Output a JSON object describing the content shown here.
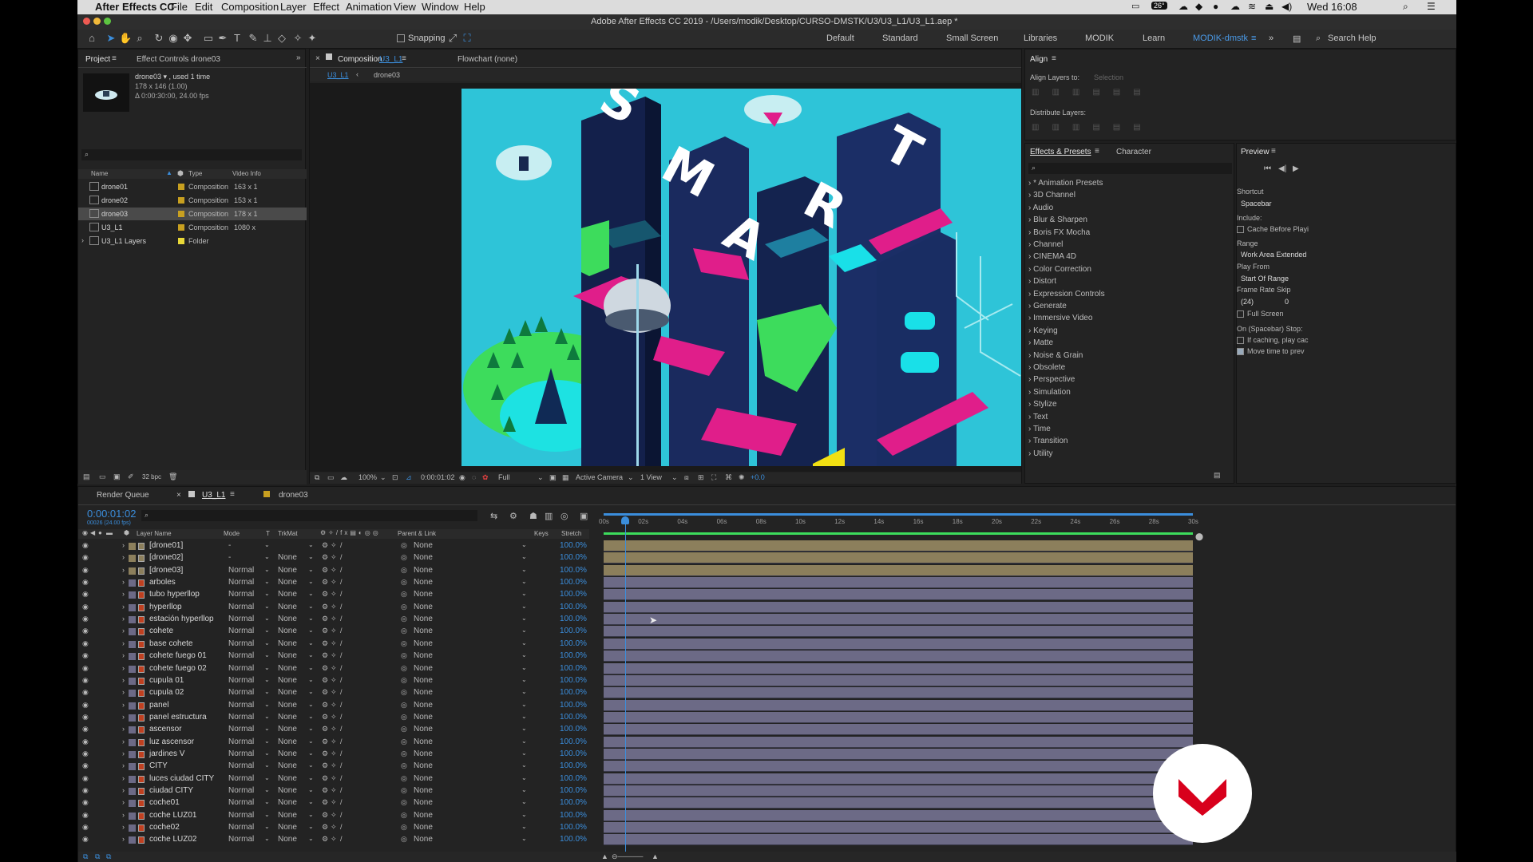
{
  "menubar": {
    "app": "After Effects CC",
    "items": [
      "File",
      "Edit",
      "Composition",
      "Layer",
      "Effect",
      "Animation",
      "View",
      "Window",
      "Help"
    ],
    "temp": "26°",
    "clock": "Wed 16:08"
  },
  "titlebar": {
    "title": "Adobe After Effects CC 2019 - /Users/modik/Desktop/CURSO-DMSTK/U3/U3_L1/U3_L1.aep *"
  },
  "toolbar": {
    "snapping": "Snapping",
    "workspaces": [
      "Default",
      "Standard",
      "Small Screen",
      "Libraries",
      "MODIK",
      "Learn"
    ],
    "active_workspace": "MODIK-dmstk",
    "search_placeholder": "Search Help"
  },
  "project": {
    "tab_project": "Project",
    "tab_effect_controls": "Effect Controls drone03",
    "selected_name": "drone03 ▾ , used 1 time",
    "selected_dims": "178 x 146 (1.00)",
    "selected_dur": "Δ 0:00:30:00, 24.00 fps",
    "columns": {
      "name": "Name",
      "type": "Type",
      "video": "Video Info"
    },
    "items": [
      {
        "name": "drone01",
        "type": "Composition",
        "info": "163 x 1"
      },
      {
        "name": "drone02",
        "type": "Composition",
        "info": "153 x 1"
      },
      {
        "name": "drone03",
        "type": "Composition",
        "info": "178 x 1"
      },
      {
        "name": "U3_L1",
        "type": "Composition",
        "info": "1080 x"
      },
      {
        "name": "U3_L1 Layers",
        "type": "Folder",
        "info": ""
      }
    ],
    "bpc": "32 bpc"
  },
  "composition": {
    "tab_label": "Composition",
    "tab_comp": "U3_L1",
    "flowchart": "Flowchart (none)",
    "crumb1": "U3_L1",
    "crumb2": "drone03",
    "zoom": "100%",
    "timecode": "0:00:01:02",
    "resolution": "Full",
    "camera": "Active Camera",
    "views": "1 View",
    "exposure": "+0.0",
    "art_text": "SMART"
  },
  "align": {
    "title": "Align",
    "align_to": "Align Layers to:",
    "selection": "Selection",
    "distribute": "Distribute Layers:"
  },
  "effects": {
    "tab": "Effects & Presets",
    "tab2": "Character",
    "categories": [
      "* Animation Presets",
      "3D Channel",
      "Audio",
      "Blur & Sharpen",
      "Boris FX Mocha",
      "Channel",
      "CINEMA 4D",
      "Color Correction",
      "Distort",
      "Expression Controls",
      "Generate",
      "Immersive Video",
      "Keying",
      "Matte",
      "Noise & Grain",
      "Obsolete",
      "Perspective",
      "Simulation",
      "Stylize",
      "Text",
      "Time",
      "Transition",
      "Utility"
    ]
  },
  "preview": {
    "title": "Preview",
    "shortcut_label": "Shortcut",
    "shortcut_value": "Spacebar",
    "include": "Include:",
    "cache": "Cache Before Playi",
    "range_label": "Range",
    "range_value": "Work Area Extended",
    "playfrom_label": "Play From",
    "playfrom_value": "Start Of Range",
    "framerate_label": "Frame Rate",
    "skip_label": "Skip",
    "framerate_value": "(24)",
    "skip_value": "0",
    "fullscreen": "Full Screen",
    "stop_label": "On (Spacebar) Stop:",
    "ifcaching": "If caching, play cac",
    "movetime": "Move time to prev"
  },
  "timeline": {
    "tab_render": "Render Queue",
    "tab_comp": "U3_L1",
    "tab_drone": "drone03",
    "timecode": "0:00:01:02",
    "fps_line": "00026 (24.00 fps)",
    "col_layer": "Layer Name",
    "col_mode": "Mode",
    "col_t": "T",
    "col_trk": "TrkMat",
    "col_parent": "Parent & Link",
    "col_keys": "Keys",
    "col_stretch": "Stretch",
    "ruler": [
      "00s",
      "02s",
      "04s",
      "06s",
      "08s",
      "10s",
      "12s",
      "14s",
      "16s",
      "18s",
      "20s",
      "22s",
      "24s",
      "26s",
      "28s",
      "30s"
    ],
    "playhead_seconds": 1.08,
    "layers": [
      {
        "name": "[drone01]",
        "mode": "-",
        "trk": "",
        "parent": "None",
        "stretch": "100.0%",
        "comp": true
      },
      {
        "name": "[drone02]",
        "mode": "-",
        "trk": "None",
        "parent": "None",
        "stretch": "100.0%",
        "comp": true
      },
      {
        "name": "[drone03]",
        "mode": "Normal",
        "trk": "None",
        "parent": "None",
        "stretch": "100.0%",
        "comp": true
      },
      {
        "name": "arboles",
        "mode": "Normal",
        "trk": "None",
        "parent": "None",
        "stretch": "100.0%"
      },
      {
        "name": "tubo hyperllop",
        "mode": "Normal",
        "trk": "None",
        "parent": "None",
        "stretch": "100.0%"
      },
      {
        "name": "hyperllop",
        "mode": "Normal",
        "trk": "None",
        "parent": "None",
        "stretch": "100.0%"
      },
      {
        "name": "estación hyperllop",
        "mode": "Normal",
        "trk": "None",
        "parent": "None",
        "stretch": "100.0%"
      },
      {
        "name": "cohete",
        "mode": "Normal",
        "trk": "None",
        "parent": "None",
        "stretch": "100.0%"
      },
      {
        "name": "base cohete",
        "mode": "Normal",
        "trk": "None",
        "parent": "None",
        "stretch": "100.0%"
      },
      {
        "name": "cohete fuego 01",
        "mode": "Normal",
        "trk": "None",
        "parent": "None",
        "stretch": "100.0%"
      },
      {
        "name": "cohete fuego 02",
        "mode": "Normal",
        "trk": "None",
        "parent": "None",
        "stretch": "100.0%"
      },
      {
        "name": "cupula 01",
        "mode": "Normal",
        "trk": "None",
        "parent": "None",
        "stretch": "100.0%"
      },
      {
        "name": "cupula 02",
        "mode": "Normal",
        "trk": "None",
        "parent": "None",
        "stretch": "100.0%"
      },
      {
        "name": "panel",
        "mode": "Normal",
        "trk": "None",
        "parent": "None",
        "stretch": "100.0%"
      },
      {
        "name": "panel estructura",
        "mode": "Normal",
        "trk": "None",
        "parent": "None",
        "stretch": "100.0%"
      },
      {
        "name": "ascensor",
        "mode": "Normal",
        "trk": "None",
        "parent": "None",
        "stretch": "100.0%"
      },
      {
        "name": "luz ascensor",
        "mode": "Normal",
        "trk": "None",
        "parent": "None",
        "stretch": "100.0%"
      },
      {
        "name": "jardines V",
        "mode": "Normal",
        "trk": "None",
        "parent": "None",
        "stretch": "100.0%"
      },
      {
        "name": "CITY",
        "mode": "Normal",
        "trk": "None",
        "parent": "None",
        "stretch": "100.0%"
      },
      {
        "name": "luces ciudad CITY",
        "mode": "Normal",
        "trk": "None",
        "parent": "None",
        "stretch": "100.0%"
      },
      {
        "name": "ciudad CITY",
        "mode": "Normal",
        "trk": "None",
        "parent": "None",
        "stretch": "100.0%"
      },
      {
        "name": "coche01",
        "mode": "Normal",
        "trk": "None",
        "parent": "None",
        "stretch": "100.0%"
      },
      {
        "name": "coche LUZ01",
        "mode": "Normal",
        "trk": "None",
        "parent": "None",
        "stretch": "100.0%"
      },
      {
        "name": "coche02",
        "mode": "Normal",
        "trk": "None",
        "parent": "None",
        "stretch": "100.0%"
      },
      {
        "name": "coche LUZ02",
        "mode": "Normal",
        "trk": "None",
        "parent": "None",
        "stretch": "100.0%"
      }
    ]
  },
  "colors": {
    "accent": "#3b8edc",
    "comp_bar": "#8c7f5c",
    "layer_bar": "#6c6a86",
    "viewer_bg": "#2ec4d8",
    "brand": "#d8001c"
  }
}
